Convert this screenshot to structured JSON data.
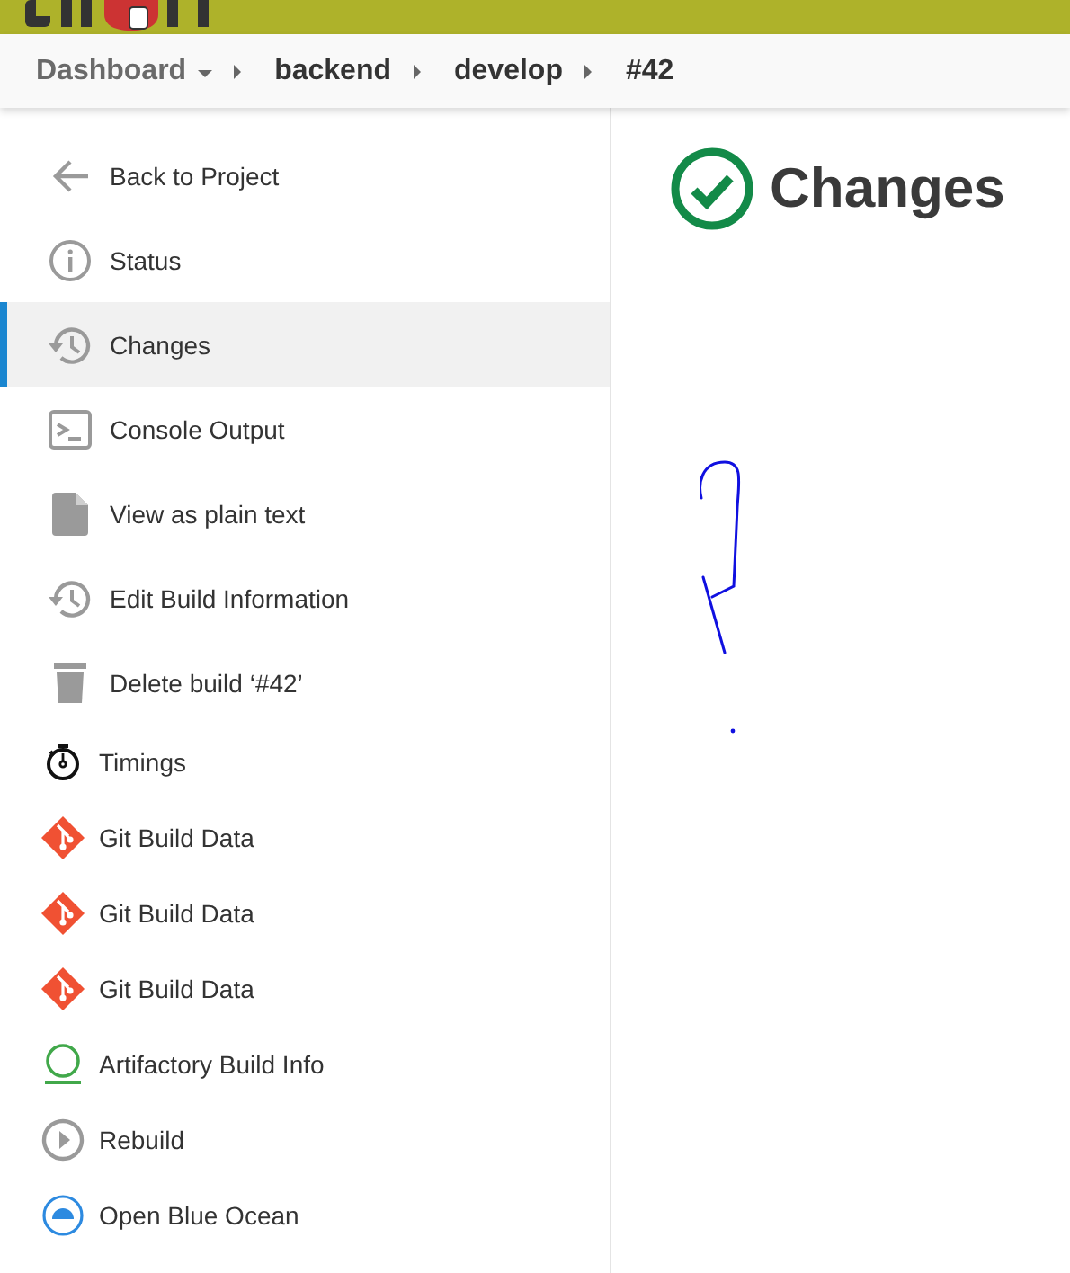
{
  "breadcrumbs": [
    {
      "label": "Dashboard",
      "dropdown": true
    },
    {
      "label": "backend",
      "dropdown": false
    },
    {
      "label": "develop",
      "dropdown": false
    },
    {
      "label": "#42",
      "dropdown": false
    }
  ],
  "sidebar": {
    "items": [
      {
        "label": "Back to Project",
        "kind": "arrow",
        "selected": false
      },
      {
        "label": "Status",
        "kind": "info",
        "selected": false
      },
      {
        "label": "Changes",
        "kind": "history",
        "selected": true
      },
      {
        "label": "Console Output",
        "kind": "terminal",
        "selected": false
      },
      {
        "label": "View as plain text",
        "kind": "file",
        "selected": false
      },
      {
        "label": "Edit Build Information",
        "kind": "history",
        "selected": false
      },
      {
        "label": "Delete build ‘#42’",
        "kind": "trash",
        "selected": false
      },
      {
        "label": "Timings",
        "kind": "stopwatch",
        "selected": false
      },
      {
        "label": "Git Build Data",
        "kind": "git",
        "selected": false
      },
      {
        "label": "Git Build Data",
        "kind": "git",
        "selected": false
      },
      {
        "label": "Git Build Data",
        "kind": "git",
        "selected": false
      },
      {
        "label": "Artifactory Build Info",
        "kind": "artifactory",
        "selected": false
      },
      {
        "label": "Rebuild",
        "kind": "play",
        "selected": false
      },
      {
        "label": "Open Blue Ocean",
        "kind": "ocean",
        "selected": false
      }
    ]
  },
  "main": {
    "title": "Changes",
    "succeeded": true
  }
}
